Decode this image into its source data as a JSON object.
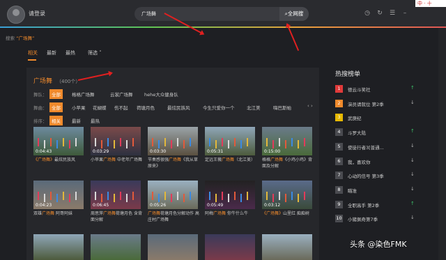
{
  "header": {
    "login": "请登录",
    "search_value": "广场舞",
    "search_button": "全网搜",
    "logo_text": "中 · 十"
  },
  "breadcrumb": {
    "prefix": "搜索",
    "keyword": "“广场舞”"
  },
  "tabs": [
    {
      "label": "相关",
      "active": true
    },
    {
      "label": "最新"
    },
    {
      "label": "最热"
    },
    {
      "label": "筛选"
    }
  ],
  "results": {
    "title": "广场舞",
    "count": "（400个）",
    "team_label": "舞队：",
    "teams": [
      "全部",
      "格格广场舞",
      "云裳广场舞",
      "hehe大众健身队"
    ],
    "song_label": "舞曲：",
    "songs": [
      "全部",
      "小苹果",
      "花蝴蝶",
      "伤不起",
      "荷塘月色",
      "最炫民族风",
      "今生只爱你一个",
      "北江美",
      "嗨巴斯帕"
    ],
    "sort_label": "排序：",
    "sorts": [
      "相关",
      "最新",
      "最热"
    ]
  },
  "videos": [
    {
      "duration": "0:04:43",
      "caption_hl": "《广场舞》",
      "caption_rest": "最炫民族风"
    },
    {
      "duration": "0:03:29",
      "caption_pre": "小苹果",
      "caption_hl": "广场舞",
      "caption_rest": " 中老年广场舞"
    },
    {
      "duration": "0:03:30",
      "caption_pre": "节奏感很强",
      "caption_hl": "广场舞",
      "caption_rest": "《我从草原来》"
    },
    {
      "duration": "0:05:31",
      "caption_pre": "定远王薇",
      "caption_hl": "广场舞",
      "caption_rest": "（北江美）"
    },
    {
      "duration": "0:15:00",
      "caption_pre": "格格",
      "caption_hl": "广场舞",
      "caption_rest": "《小鸡小鸡》背面及分解"
    },
    {
      "duration": "0:04:23",
      "caption_pre": "双雄",
      "caption_hl": "广场舞",
      "caption_rest": " 阿哥阿妹"
    },
    {
      "duration": "0:06:45",
      "caption_pre": "周思萍",
      "caption_hl": "广场舞",
      "caption_rest": "荷塘月色 含背面分解"
    },
    {
      "duration": "0:05:26",
      "caption_hl": "广场舞",
      "caption_rest": "荷塘月色分解动作 高庄村广场舞"
    },
    {
      "duration": "0:05:49",
      "caption_pre": "阿梅",
      "caption_hl": "广场舞",
      "caption_rest": " 你牛什么牛"
    },
    {
      "duration": "0:03:12",
      "caption_hl": "《广场舞》",
      "caption_rest": "山里红 痴痴树"
    }
  ],
  "hot_list": {
    "title": "热搜榜单",
    "items": [
      {
        "rank": "1",
        "text": "德云斗笑社",
        "trend": "up"
      },
      {
        "rank": "2",
        "text": "演员请就位 第2季",
        "trend": "down"
      },
      {
        "rank": "3",
        "text": "武庚纪",
        "trend": "flat"
      },
      {
        "rank": "4",
        "text": "斗罗大陆",
        "trend": "up"
      },
      {
        "rank": "5",
        "text": "使徒行者3[普通...",
        "trend": "down"
      },
      {
        "rank": "6",
        "text": "我，喜欢你",
        "trend": "down"
      },
      {
        "rank": "7",
        "text": "心动的信号 第3季",
        "trend": "down"
      },
      {
        "rank": "8",
        "text": "瞄准",
        "trend": "down"
      },
      {
        "rank": "9",
        "text": "全职高手 第2季",
        "trend": "up"
      },
      {
        "rank": "10",
        "text": "小猪佩奇第7季",
        "trend": "down"
      }
    ]
  },
  "watermark": "头条 @染色FMK",
  "colors": {
    "accent": "#f08a2c",
    "rank1": "#e03a3a",
    "rank2": "#f08a2c",
    "rank3": "#e6b800",
    "rank_other": "#4a4b50",
    "up": "#3cc26a",
    "down": "#b0b0b0"
  }
}
